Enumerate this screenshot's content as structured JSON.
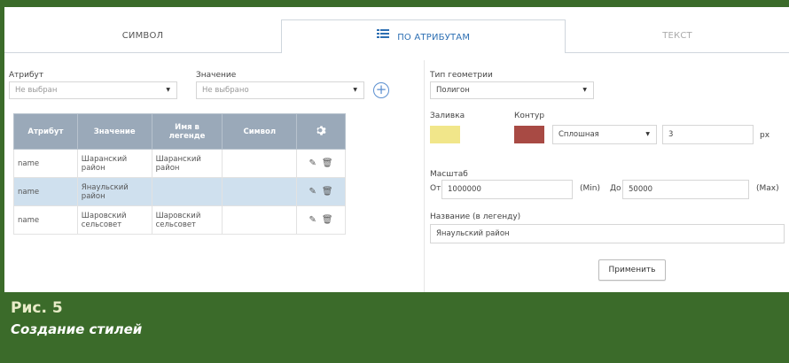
{
  "tabs": [
    {
      "label": "СИМВОЛ"
    },
    {
      "label": "ПО АТРИБУТАМ"
    },
    {
      "label": "ТЕКСТ"
    }
  ],
  "filter": {
    "attribute_label": "Атрибут",
    "attribute_value": "Не выбран",
    "value_label": "Значение",
    "value_value": "Не выбрано"
  },
  "table": {
    "headers": [
      "Атрибут",
      "Значение",
      "Имя в легенде",
      "Символ"
    ],
    "rows": [
      {
        "attr": "name",
        "value": "Шаранский район",
        "legend": "Шаранский район",
        "symbol": ""
      },
      {
        "attr": "name",
        "value": "Янаульский район",
        "legend": "",
        "symbol": ""
      },
      {
        "attr": "name",
        "value": "Шаровский сельсовет",
        "legend": "Шаровский сельсовет",
        "symbol": ""
      }
    ],
    "selected_row": 1
  },
  "style": {
    "geom_label": "Тип геометрии",
    "geom_value": "Полигон",
    "fill_label": "Заливка",
    "fill_color": "#f1e68a",
    "outline_label": "Контур",
    "outline_color": "#a84a44",
    "line_style": "Сплошная",
    "line_width": "3",
    "unit": "px",
    "scale_label": "Масштаб",
    "from_label": "От",
    "from_value": "1000000",
    "min_label": "(Min)",
    "to_label": "До",
    "to_value": "50000",
    "max_label": "(Max)",
    "legend_name_label": "Название (в легенду)",
    "legend_name_value": "Янаульский район",
    "apply_label": "Применить"
  },
  "caption": {
    "title": "Рис. 5",
    "text": "Создание стилей"
  },
  "colors": {
    "frame": "#3b6b2a",
    "header": "#9aa9b9",
    "selected_row": "#cfe0ee",
    "accent": "#2d6fb3"
  },
  "icons": {
    "tab2": "list-icon",
    "settings": "gear-icon",
    "edit": "pencil-icon",
    "delete": "trash-icon",
    "add": "plus-circle-icon"
  }
}
